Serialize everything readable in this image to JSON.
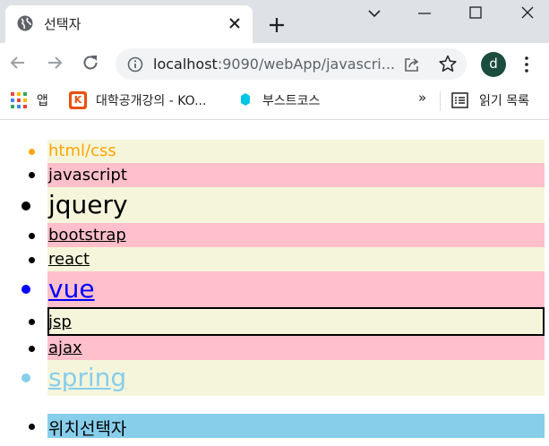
{
  "browser": {
    "tab_title": "선택자",
    "url_host": "localhost",
    "url_rest": ":9090/webApp/javascri...",
    "profile_initial": "d"
  },
  "bookmarks": {
    "apps": "앱",
    "kocw": "대학공개강의 - KO...",
    "boostcourse": "부스트코스",
    "more": "»",
    "reading_list": "읽기 목록"
  },
  "page": {
    "items": [
      {
        "label": "html/css",
        "style": "orange-text"
      },
      {
        "label": "javascript",
        "style": "plain"
      },
      {
        "label": "jquery",
        "style": "large"
      },
      {
        "label": "bootstrap",
        "style": "underlined"
      },
      {
        "label": "react",
        "style": "underlined"
      },
      {
        "label": "vue",
        "style": "blue-large-underlined"
      },
      {
        "label": "jsp",
        "style": "bordered-underlined"
      },
      {
        "label": "ajax",
        "style": "underlined"
      },
      {
        "label": "spring",
        "style": "skyblue-large-underlined"
      }
    ],
    "position_item": "위치선택자"
  },
  "colors": {
    "beige": "#f5f5dc",
    "pink": "#ffc0cb",
    "skyblue": "#87ceeb",
    "orange": "#ffa500",
    "blue": "#0000ff"
  }
}
